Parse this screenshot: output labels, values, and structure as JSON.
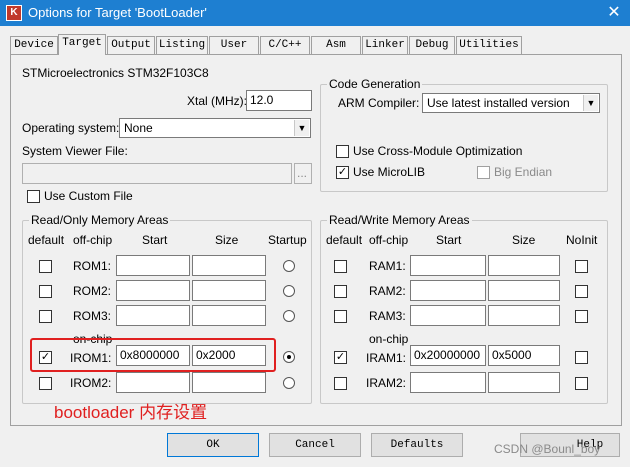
{
  "window": {
    "title": "Options for Target 'BootLoader'",
    "icon": "keil-app-icon"
  },
  "tabs": [
    {
      "label": "Device"
    },
    {
      "label": "Target"
    },
    {
      "label": "Output"
    },
    {
      "label": "Listing"
    },
    {
      "label": "User"
    },
    {
      "label": "C/C++"
    },
    {
      "label": "Asm"
    },
    {
      "label": "Linker"
    },
    {
      "label": "Debug"
    },
    {
      "label": "Utilities"
    }
  ],
  "target": {
    "device_name": "STMicroelectronics STM32F103C8",
    "xtal_label": "Xtal (MHz):",
    "xtal_value": "12.0",
    "os_label": "Operating system:",
    "os_value": "None",
    "svf_label": "System Viewer File:",
    "svf_value": "",
    "browse_label": "...",
    "custom_file_label": "Use Custom File"
  },
  "code_generation": {
    "title": "Code Generation",
    "compiler_label": "ARM Compiler:",
    "compiler_value": "Use latest installed version",
    "cross_module_label": "Use Cross-Module Optimization",
    "microlib_label": "Use MicroLIB",
    "microlib_checked": true,
    "big_endian_label": "Big Endian"
  },
  "rom_areas": {
    "title": "Read/Only Memory Areas",
    "headers": {
      "default": "default",
      "offchip": "off-chip",
      "start": "Start",
      "size": "Size",
      "startup": "Startup"
    },
    "onchip_label": "on-chip",
    "rows": [
      {
        "label": "ROM1:",
        "start": "",
        "size": "",
        "default": false,
        "startup": false
      },
      {
        "label": "ROM2:",
        "start": "",
        "size": "",
        "default": false,
        "startup": false
      },
      {
        "label": "ROM3:",
        "start": "",
        "size": "",
        "default": false,
        "startup": false
      },
      {
        "label": "IROM1:",
        "start": "0x8000000",
        "size": "0x2000",
        "default": true,
        "startup": true
      },
      {
        "label": "IROM2:",
        "start": "",
        "size": "",
        "default": false,
        "startup": false
      }
    ]
  },
  "ram_areas": {
    "title": "Read/Write Memory Areas",
    "headers": {
      "default": "default",
      "offchip": "off-chip",
      "start": "Start",
      "size": "Size",
      "noinit": "NoInit"
    },
    "onchip_label": "on-chip",
    "rows": [
      {
        "label": "RAM1:",
        "start": "",
        "size": "",
        "default": false
      },
      {
        "label": "RAM2:",
        "start": "",
        "size": "",
        "default": false
      },
      {
        "label": "RAM3:",
        "start": "",
        "size": "",
        "default": false
      },
      {
        "label": "IRAM1:",
        "start": "0x20000000",
        "size": "0x5000",
        "default": true
      },
      {
        "label": "IRAM2:",
        "start": "",
        "size": "",
        "default": false
      }
    ]
  },
  "buttons": {
    "ok": "OK",
    "cancel": "Cancel",
    "defaults": "Defaults",
    "help": "Help"
  },
  "annotation": "bootloader 内存设置",
  "watermark": "CSDN @Bounl_boy",
  "colors": {
    "titlebar": "#1e7fd1",
    "annotation": "#e02020"
  }
}
